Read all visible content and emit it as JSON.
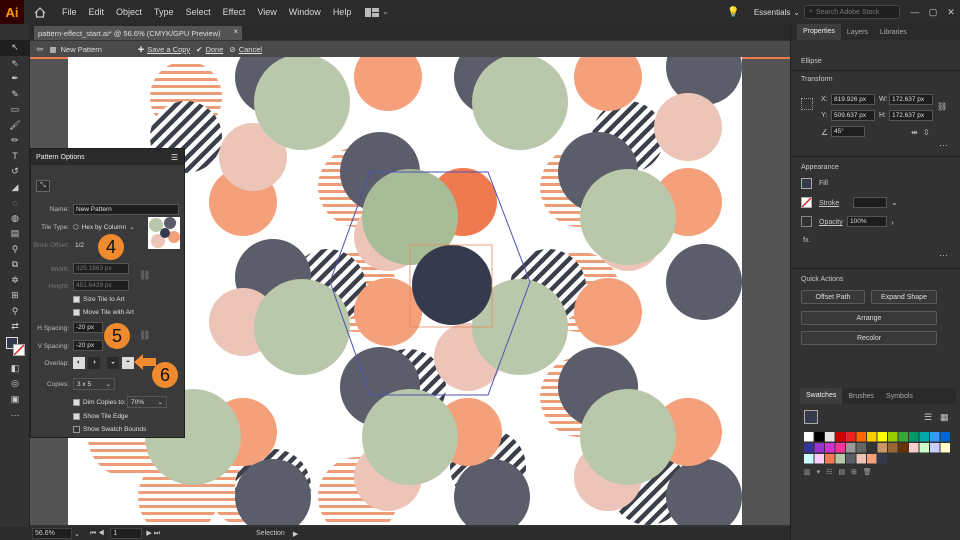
{
  "app": {
    "logo": "Ai"
  },
  "menu": [
    "File",
    "Edit",
    "Object",
    "Type",
    "Select",
    "Effect",
    "View",
    "Window",
    "Help"
  ],
  "workspace": "Essentials",
  "search_placeholder": "Search Adobe Stock",
  "document_tab": {
    "title": "pattern-effect_start.ai* @ 56.6% (CMYK/GPU Preview)",
    "close": "×"
  },
  "isolation": {
    "name": "New Pattern",
    "save_copy": "Save a Copy",
    "done": "Done",
    "cancel": "Cancel"
  },
  "status": {
    "zoom": "56.6%",
    "artboard": "1",
    "tool": "Selection"
  },
  "properties_panel": {
    "tabs": [
      "Properties",
      "Layers",
      "Libraries"
    ],
    "object": "Ellipse",
    "transform_title": "Transform",
    "x": "819.926 px",
    "y": "509.637 px",
    "w": "172.637 px",
    "h": "172.637 px",
    "angle": "45°",
    "appearance_title": "Appearance",
    "fill": "Fill",
    "stroke": "Stroke",
    "opacity": "Opacity",
    "opacity_value": "100%",
    "fx": "fx.",
    "quick_actions_title": "Quick Actions",
    "offset_path": "Offset Path",
    "expand_shape": "Expand Shape",
    "arrange": "Arrange",
    "recolor": "Recolor"
  },
  "swatches_panel": {
    "tabs": [
      "Swatches",
      "Brushes",
      "Symbols"
    ]
  },
  "pattern_options": {
    "title": "Pattern Options",
    "name_label": "Name:",
    "name_value": "New Pattern",
    "tile_type_label": "Tile Type:",
    "tile_type_value": "Hex by Column",
    "brick_offset_label": "Brick Offset:",
    "brick_offset_value": "1/2",
    "width_label": "Width:",
    "width_value": "325.1863 px",
    "height_label": "Height:",
    "height_value": "451.6429 px",
    "size_tile": "Size Tile to Art",
    "move_tile": "Move Tile with Art",
    "h_spacing_label": "H Spacing:",
    "h_spacing_value": "-20 px",
    "v_spacing_label": "V Spacing:",
    "v_spacing_value": "-20 px",
    "overlap_label": "Overlap:",
    "copies_label": "Copies:",
    "copies_value": "3 x 5",
    "dim_copies": "Dim Copies to:",
    "dim_value": "70%",
    "show_tile_edge": "Show Tile Edge",
    "show_swatch_bounds": "Show Swatch Bounds"
  },
  "callouts": [
    "4",
    "5",
    "6"
  ],
  "colors": {
    "salmon": "#f4a07a",
    "sage": "#b9c8aa",
    "slate": "#5b5e6a",
    "pink": "#ecc4b8",
    "orange": "#ef7a4f",
    "accent": "#ef8a2e",
    "navy": "#353a4d"
  }
}
